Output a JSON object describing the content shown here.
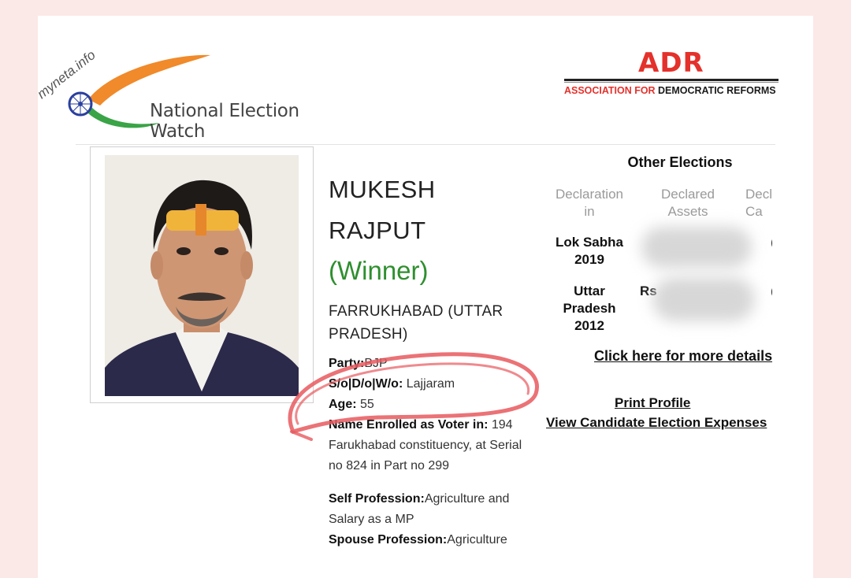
{
  "header": {
    "myneta_brand": "myneta.info",
    "tagline": "National Election Watch",
    "adr_logo": "ADR",
    "adr_full_a": "ASSOCIATION FOR ",
    "adr_full_b": "DEMOCRATIC REFORMS"
  },
  "candidate": {
    "name_line1": "MUKESH",
    "name_line2": "RAJPUT",
    "status": "(Winner)",
    "constituency": "FARRUKHABAD (UTTAR PRADESH)",
    "party_label": "Party:",
    "party_value": "BJP",
    "relation_label": "S/o|D/o|W/o:",
    "relation_value": " Lajjaram",
    "age_label": "Age:",
    "age_value": " 55",
    "voter_label": "Name Enrolled as Voter in:",
    "voter_value": " 194 Farukhabad constituency, at Serial no 824 in Part no 299",
    "self_prof_label": "Self Profession:",
    "self_prof_value": "Agriculture and Salary as a MP",
    "spouse_prof_label": "Spouse Profession:",
    "spouse_prof_value": "Agriculture"
  },
  "other_elections": {
    "title": "Other Elections",
    "columns": [
      "Declaration in",
      "Declared Assets",
      "Decl Ca"
    ],
    "rows": [
      {
        "election": "Lok Sabha 2019",
        "assets": "",
        "cases": "("
      },
      {
        "election": "Uttar Pradesh 2012",
        "assets": "Rs",
        "cases": "("
      }
    ],
    "more_link": "Click here for more details"
  },
  "links": {
    "print_profile": "Print Profile",
    "expenses": "View Candidate Election Expenses"
  },
  "colors": {
    "winner": "#2f8f2f",
    "adr_red": "#e4312b",
    "background": "#fbe9e7",
    "annotation": "#e8595e"
  }
}
